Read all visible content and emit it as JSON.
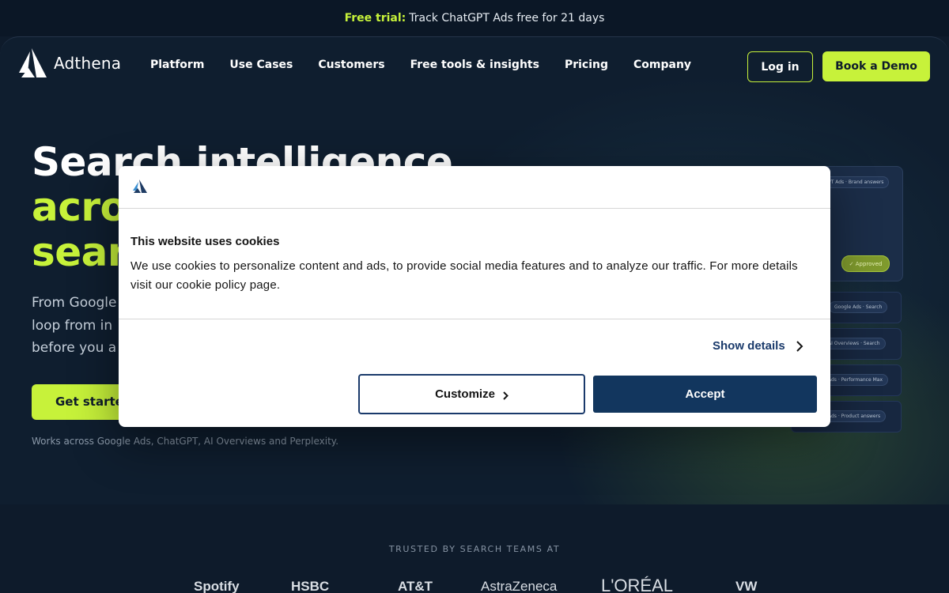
{
  "announcement": {
    "highlight": "Free trial:",
    "text": "Track ChatGPT Ads free for 21 days"
  },
  "header": {
    "brand": "Adthena",
    "nav": [
      "Platform",
      "Use Cases",
      "Customers",
      "Free tools & insights",
      "Pricing",
      "Company"
    ],
    "login_label": "Log in",
    "demo_label": "Book a Demo"
  },
  "hero": {
    "title_line1": "Search intelligence",
    "title_line2": "acro",
    "title_line3": "sear",
    "subtitle_line1": "From Google",
    "subtitle_line2": "loop from in",
    "subtitle_line3": "before you a",
    "cta_label": "Get started",
    "works_note": "Works across Google Ads, ChatGPT, AI Overviews and Perplexity."
  },
  "visual": {
    "tag_top": "PT Ads · Brand answers",
    "approved": "✓ Approved",
    "cards": [
      "Google Ads · Search",
      "AI Overviews · Search",
      "Ads · Performance Max",
      "Ads · Product answers"
    ]
  },
  "trusted": {
    "label": "TRUSTED BY SEARCH TEAMS AT",
    "brands": [
      "Spotify",
      "HSBC",
      "AT&T",
      "AstraZeneca",
      "L'ORÉAL",
      "VW"
    ]
  },
  "cookie": {
    "title": "This website uses cookies",
    "body": "We use cookies to personalize content and ads, to provide social media features and to analyze our traffic. For more details visit our cookie policy page.",
    "show_details": "Show details",
    "customize": "Customize",
    "accept": "Accept"
  },
  "colors": {
    "accent": "#c7f23a",
    "background": "#0e1b2b",
    "cookie_primary": "#12365e"
  }
}
